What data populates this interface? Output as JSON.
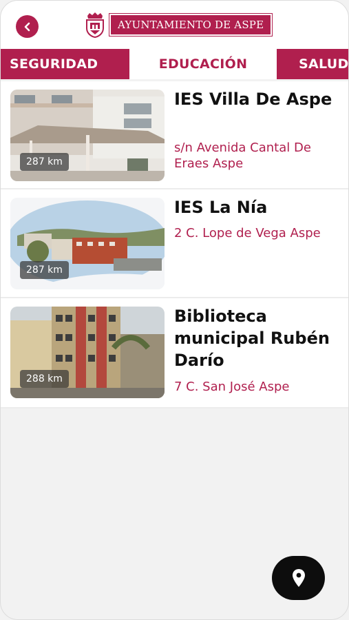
{
  "header": {
    "brand": "AYUNTAMIENTO DE ASPE"
  },
  "tabs": [
    {
      "label": "SEGURIDAD",
      "active": false
    },
    {
      "label": "EDUCACIÓN",
      "active": true
    },
    {
      "label": "SALUD",
      "active": false
    }
  ],
  "places": [
    {
      "name": "IES Villa De Aspe",
      "address": "s/n Avenida Cantal De Eraes Aspe",
      "distance": "287 km"
    },
    {
      "name": "IES La Nía",
      "address": "2 C. Lope de Vega Aspe",
      "distance": "287 km"
    },
    {
      "name": "Biblioteca municipal Rubén Darío",
      "address": "7 C. San José Aspe",
      "distance": "288 km"
    }
  ],
  "colors": {
    "accent": "#b01f4e",
    "background": "#f2f2f2",
    "fab": "#0d0d0d"
  },
  "icons": {
    "back": "chevron-left-icon",
    "fab": "map-pin-icon"
  }
}
